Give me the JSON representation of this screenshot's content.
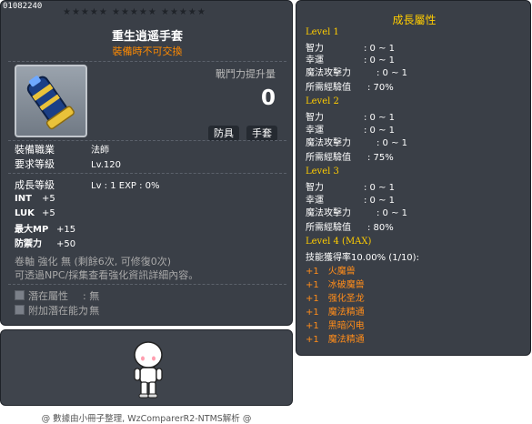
{
  "item": {
    "id": "01082240",
    "stars": "★★★★★ ★★★★★ ★★★★★",
    "name": "重生逍遥手套",
    "trade_note": "裝備時不可交換",
    "power_label": "戰鬥力提升量",
    "power_value": "0",
    "tags": [
      "防具",
      "手套"
    ],
    "job_label": "裝備職業",
    "job_value": "法師",
    "req_level_label": "要求等級",
    "req_level_value": "Lv.120",
    "growth_label": "成長等級",
    "growth_value": "Lv : 1   EXP : 0%",
    "stats": [
      {
        "name": "INT",
        "value": "+5"
      },
      {
        "name": "LUK",
        "value": "+5"
      },
      {
        "name": "最大MP",
        "value": "+15"
      },
      {
        "name": "防禦力",
        "value": "+50"
      }
    ],
    "upgrade_line": "卷軸 強化 無 (剩餘6次, 可修復0次)",
    "info_line": "可透過NPC/採集查看強化資訊詳細內容。",
    "potential": {
      "label": "潛在屬性",
      "value": ": 無"
    },
    "bonus_potential": {
      "label": "附加潛在能力",
      "value": ": 無"
    }
  },
  "growth": {
    "title": "成長屬性",
    "levels": [
      {
        "label": "Level 1",
        "lines": [
          {
            "k": "智力",
            "v": ": 0 ~ 1"
          },
          {
            "k": "幸運",
            "v": ": 0 ~ 1"
          },
          {
            "k": "魔法攻擊力",
            "v": ": 0 ~ 1"
          },
          {
            "k": "所需經驗值",
            "v": ": 70%"
          }
        ]
      },
      {
        "label": "Level 2",
        "lines": [
          {
            "k": "智力",
            "v": ": 0 ~ 1"
          },
          {
            "k": "幸運",
            "v": ": 0 ~ 1"
          },
          {
            "k": "魔法攻擊力",
            "v": ": 0 ~ 1"
          },
          {
            "k": "所需經驗值",
            "v": ": 75%"
          }
        ]
      },
      {
        "label": "Level 3",
        "lines": [
          {
            "k": "智力",
            "v": ": 0 ~ 1"
          },
          {
            "k": "幸運",
            "v": ": 0 ~ 1"
          },
          {
            "k": "魔法攻擊力",
            "v": ": 0 ~ 1"
          },
          {
            "k": "所需經驗值",
            "v": ": 80%"
          }
        ]
      }
    ],
    "level4_label": "Level 4 (MAX)",
    "skill_rate": "技能獲得率10.00% (1/10):",
    "skills": [
      {
        "plus": "+1",
        "name": "火魔兽"
      },
      {
        "plus": "+1",
        "name": "冰破魔兽"
      },
      {
        "plus": "+1",
        "name": "强化圣龙"
      },
      {
        "plus": "+1",
        "name": "魔法精通"
      },
      {
        "plus": "+1",
        "name": "黑暗闪电"
      },
      {
        "plus": "+1",
        "name": "魔法精通"
      }
    ]
  },
  "footer": "@ 數據由小冊子整理, WzComparerR2-NTMS解析 @"
}
